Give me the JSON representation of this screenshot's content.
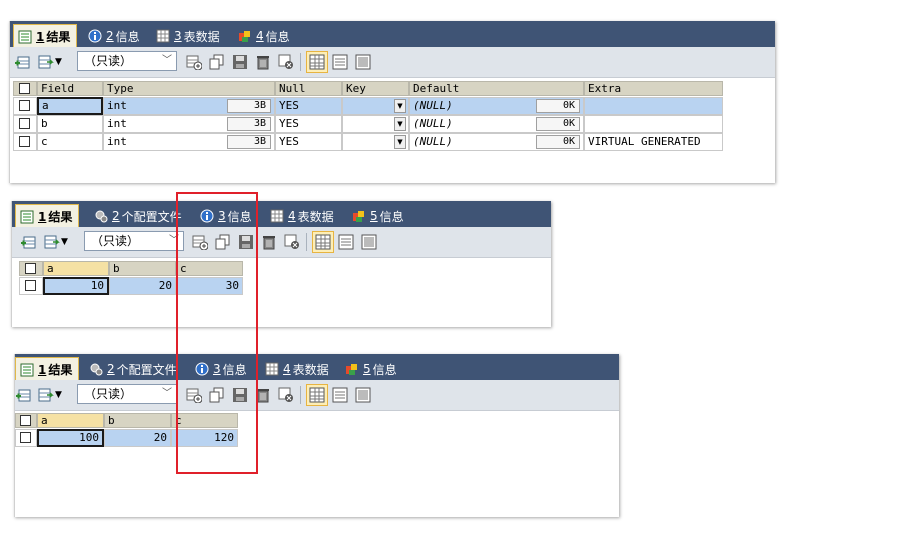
{
  "panel1": {
    "tabs": [
      {
        "num": "1",
        "label": "结果",
        "icon": "result-grid-icon"
      },
      {
        "num": "2",
        "label": "信息",
        "icon": "info-icon"
      },
      {
        "num": "3",
        "label": "表数据",
        "icon": "table-data-icon"
      },
      {
        "num": "4",
        "label": "信息",
        "icon": "info-colored-icon"
      }
    ],
    "readonly": "（只读）",
    "columns": [
      "Field",
      "Type",
      "Null",
      "Key",
      "Default",
      "Extra"
    ],
    "rows": [
      {
        "field": "a",
        "type": "int",
        "size": "3B",
        "null": "YES",
        "key": "",
        "default": "(NULL)",
        "default_size": "0K",
        "extra": ""
      },
      {
        "field": "b",
        "type": "int",
        "size": "3B",
        "null": "YES",
        "key": "",
        "default": "(NULL)",
        "default_size": "0K",
        "extra": ""
      },
      {
        "field": "c",
        "type": "int",
        "size": "3B",
        "null": "YES",
        "key": "",
        "default": "(NULL)",
        "default_size": "0K",
        "extra": "VIRTUAL GENERATED"
      }
    ]
  },
  "panel2": {
    "tabs": [
      {
        "num": "1",
        "label": "结果",
        "icon": "result-grid-icon"
      },
      {
        "num": "2",
        "label": "个配置文件",
        "icon": "profile-icon"
      },
      {
        "num": "3",
        "label": "信息",
        "icon": "info-icon"
      },
      {
        "num": "4",
        "label": "表数据",
        "icon": "table-data-icon"
      },
      {
        "num": "5",
        "label": "信息",
        "icon": "info-colored-icon"
      }
    ],
    "readonly": "（只读）",
    "columns": [
      "a",
      "b",
      "c"
    ],
    "row": [
      "10",
      "20",
      "30"
    ]
  },
  "panel3": {
    "tabs": [
      {
        "num": "1",
        "label": "结果",
        "icon": "result-grid-icon"
      },
      {
        "num": "2",
        "label": "个配置文件",
        "icon": "profile-icon"
      },
      {
        "num": "3",
        "label": "信息",
        "icon": "info-icon"
      },
      {
        "num": "4",
        "label": "表数据",
        "icon": "table-data-icon"
      },
      {
        "num": "5",
        "label": "信息",
        "icon": "info-colored-icon"
      }
    ],
    "readonly": "（只读）",
    "columns": [
      "a",
      "b",
      "c"
    ],
    "row": [
      "100",
      "20",
      "120"
    ]
  },
  "colors": {
    "tabbar": "#3f5475",
    "highlight": "#e0202a",
    "selected_cell": "#b9d3f1"
  }
}
